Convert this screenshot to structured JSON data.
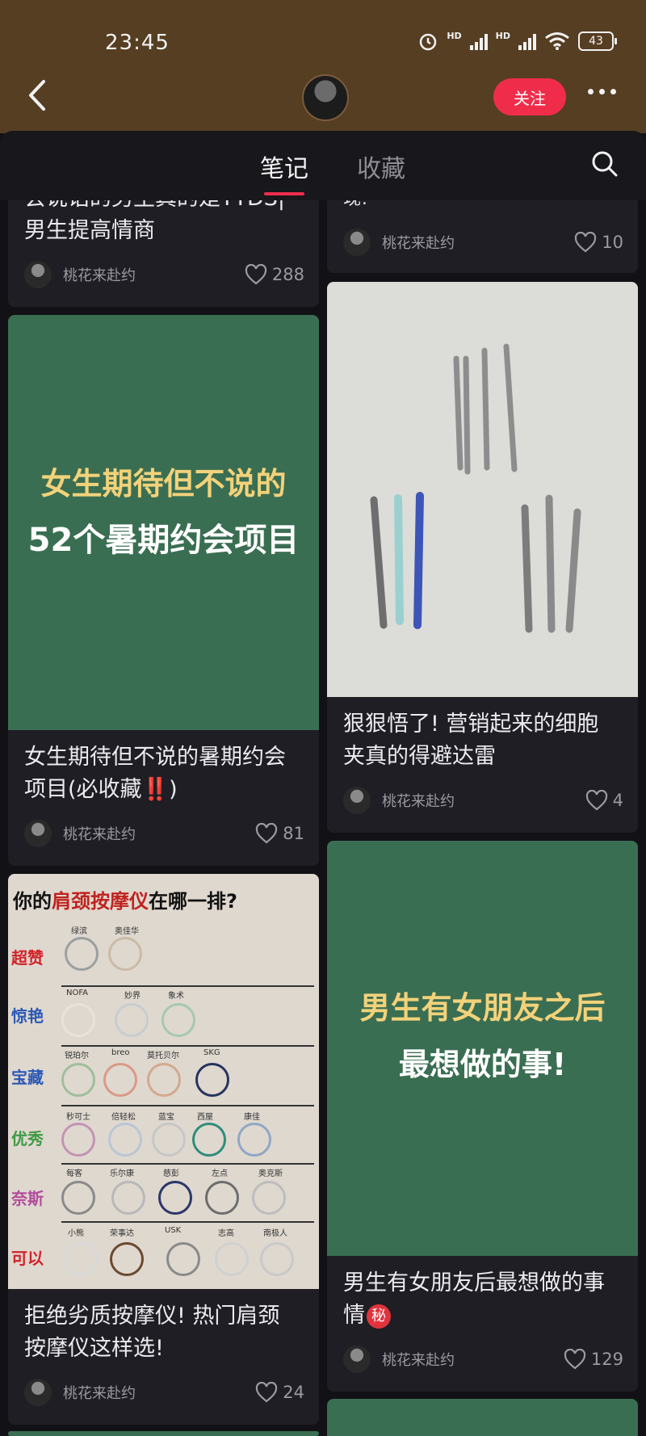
{
  "status": {
    "time": "23:45",
    "net1": "HD",
    "net2": "HD",
    "battery": "43"
  },
  "header": {
    "follow_label": "关注"
  },
  "tabs": [
    {
      "label": "笔记"
    },
    {
      "label": "收藏"
    }
  ],
  "cards": [
    {
      "title_line1": "会说话的男生真的是YYDS|",
      "title_line2": "男生提高情商",
      "author": "桃花来赴约",
      "likes": "288"
    },
    {
      "title_line1": "现!",
      "author": "桃花来赴约",
      "likes": "10"
    },
    {
      "cover_line1": "女生期待但不说的",
      "cover_line2": "52个暑期约会项目",
      "title_line1": "女生期待但不说的暑期约会",
      "title_line2": "项目(必收藏‼️)",
      "author": "桃花来赴约",
      "likes": "81"
    },
    {
      "title_line1": "狠狠悟了! 营销起来的细胞",
      "title_line2": "夹真的得避达雷",
      "author": "桃花来赴约",
      "likes": "4"
    },
    {
      "cover_title_pre": "你的",
      "cover_title_hl": "肩颈按摩仪",
      "cover_title_post": "在哪一排?",
      "tiers": [
        "超赞",
        "惊艳",
        "宝藏",
        "优秀",
        "奈斯",
        "可以"
      ],
      "brands": [
        [
          "绿滨",
          "奥佳华"
        ],
        [
          "NOFA",
          "妙界",
          "象术"
        ],
        [
          "锐珀尔",
          "breo",
          "莫托贝尔",
          "SKG"
        ],
        [
          "秒可士",
          "倍轻松",
          "蓝宝",
          "西屋",
          "康佳"
        ],
        [
          "每客",
          "乐尔康",
          "慈彭",
          "左点",
          "奥克斯"
        ],
        [
          "小熊",
          "荣事达",
          "USK",
          "志高",
          "南极人"
        ]
      ],
      "title_line1": "拒绝劣质按摩仪! 热门肩颈",
      "title_line2": "按摩仪这样选!",
      "author": "桃花来赴约",
      "likes": "24"
    },
    {
      "cover_line1": "男生有女朋友之后",
      "cover_line2": "最想做的事!",
      "title_line1": "男生有女朋友后最想做的事",
      "title_line2": "情",
      "title_badge": "秘",
      "author": "桃花来赴约",
      "likes": "129"
    }
  ],
  "colors": {
    "accent": "#ef2d4b",
    "cover_green": "#3a6e52",
    "cover_yellow": "#f3d27a",
    "header_brown": "#563e23"
  }
}
